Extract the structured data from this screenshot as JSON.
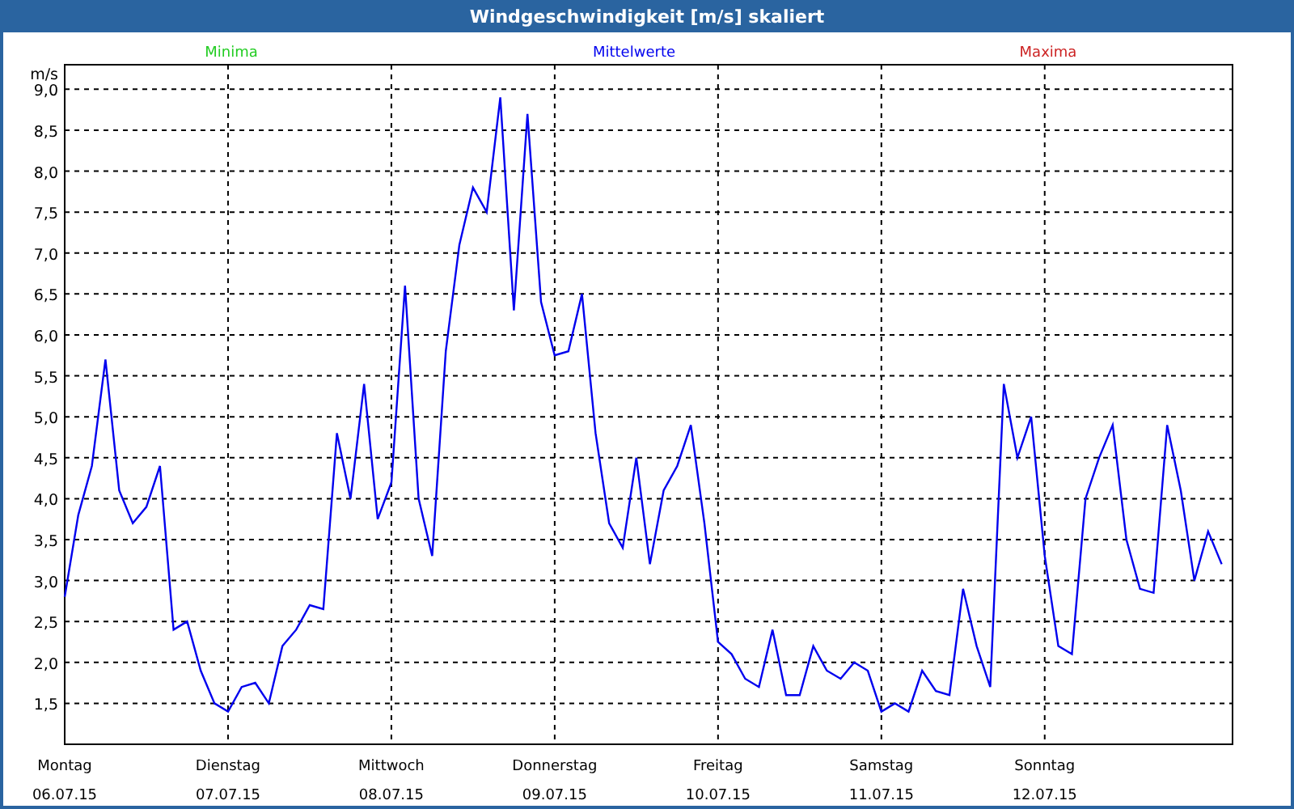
{
  "window": {
    "title": "Windgeschwindigkeit [m/s] skaliert"
  },
  "legend": [
    {
      "label": "Minima",
      "color": "#22cc22"
    },
    {
      "label": "Maxima",
      "color": "#cc2222"
    }
  ],
  "dates": [
    "06.07.15",
    "07.07.15",
    "08.07.15",
    "09.07.15",
    "10.07.15",
    "11.07.15",
    "12.07.15"
  ],
  "chart_data": {
    "type": "line",
    "grid": true,
    "ylabel": "m/s",
    "ylim": [
      1.0,
      9.3
    ],
    "yticks": [
      {
        "value": 1.5,
        "label": "1,5"
      },
      {
        "value": 2,
        "label": "2,0"
      },
      {
        "value": 2.5,
        "label": "2,5"
      },
      {
        "value": 3,
        "label": "3,0"
      },
      {
        "value": 3.5,
        "label": "3,5"
      },
      {
        "value": 4,
        "label": "4,0"
      },
      {
        "value": 4.5,
        "label": "4,5"
      },
      {
        "value": 5,
        "label": "5,0"
      },
      {
        "value": 5.5,
        "label": "5,5"
      },
      {
        "value": 6,
        "label": "6,0"
      },
      {
        "value": 6.5,
        "label": "6,5"
      },
      {
        "value": 7,
        "label": "7,0"
      },
      {
        "value": 7.5,
        "label": "7,5"
      },
      {
        "value": 8,
        "label": "8,0"
      },
      {
        "value": 8.5,
        "label": "8,5"
      },
      {
        "value": 9,
        "label": "9,0"
      }
    ],
    "categories": [
      "Montag",
      null,
      null,
      null,
      null,
      null,
      null,
      null,
      null,
      null,
      null,
      null,
      "Dienstag",
      null,
      null,
      null,
      null,
      null,
      null,
      null,
      null,
      null,
      null,
      null,
      "Mittwoch",
      null,
      null,
      null,
      null,
      null,
      null,
      null,
      null,
      null,
      null,
      null,
      "Donnerstag",
      null,
      null,
      null,
      null,
      null,
      null,
      null,
      null,
      null,
      null,
      null,
      "Freitag",
      null,
      null,
      null,
      null,
      null,
      null,
      null,
      null,
      null,
      null,
      null,
      "Samstag",
      null,
      null,
      null,
      null,
      null,
      null,
      null,
      null,
      null,
      null,
      null,
      "Sonntag",
      null,
      null,
      null,
      null,
      null,
      null,
      null,
      null,
      null,
      null,
      null,
      null,
      null
    ],
    "series": [
      {
        "name": "Mittelwerte",
        "color": "#0000ee",
        "values": [
          2.8,
          3.8,
          4.4,
          5.7,
          4.1,
          3.7,
          3.9,
          4.4,
          2.4,
          2.5,
          1.9,
          1.5,
          1.4,
          1.7,
          1.75,
          1.5,
          2.2,
          2.4,
          2.7,
          2.65,
          4.8,
          4.0,
          5.4,
          3.75,
          4.2,
          6.6,
          4.0,
          3.3,
          5.8,
          7.1,
          7.8,
          7.5,
          8.9,
          6.3,
          8.7,
          6.4,
          5.75,
          5.8,
          6.5,
          4.8,
          3.7,
          3.4,
          4.5,
          3.2,
          4.1,
          4.4,
          4.9,
          3.7,
          2.25,
          2.1,
          1.8,
          1.7,
          2.4,
          1.6,
          1.6,
          2.2,
          1.9,
          1.8,
          2.0,
          1.9,
          1.4,
          1.5,
          1.4,
          1.9,
          1.65,
          1.6,
          2.9,
          2.2,
          1.7,
          5.4,
          4.5,
          5.0,
          3.3,
          2.2,
          2.1,
          4.0,
          4.5,
          4.9,
          3.5,
          2.9,
          2.85,
          4.9,
          4.1,
          3.0,
          3.6,
          3.2
        ]
      }
    ]
  }
}
